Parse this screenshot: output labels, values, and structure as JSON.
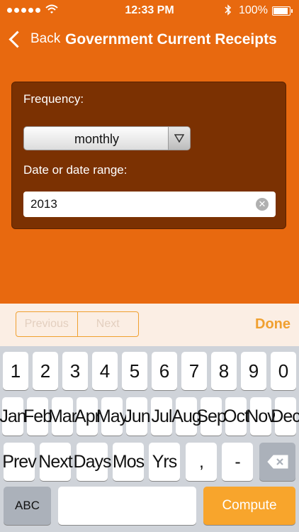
{
  "status": {
    "time": "12:33 PM",
    "battery": "100%",
    "battery_level": 1.0
  },
  "nav": {
    "back_label": "Back",
    "title": "Government Current Receipts"
  },
  "form": {
    "frequency_label": "Frequency:",
    "frequency_value": "monthly",
    "date_label": "Date or date range:",
    "date_value": "2013"
  },
  "accessory": {
    "previous": "Previous",
    "next": "Next",
    "done": "Done"
  },
  "keyboard": {
    "row1": [
      "1",
      "2",
      "3",
      "4",
      "5",
      "6",
      "7",
      "8",
      "9",
      "0"
    ],
    "row2": [
      "Jan",
      "Feb",
      "Mar",
      "Apr",
      "May",
      "Jun",
      "Jul",
      "Aug",
      "Sep",
      "Oct",
      "Nov",
      "Dec"
    ],
    "row3": [
      "Prev",
      "Next",
      "Days",
      "Mos",
      "Yrs",
      ",",
      "-"
    ],
    "abc": "ABC",
    "compute": "Compute"
  },
  "colors": {
    "background": "#e8690f",
    "panel": "#7b3102",
    "accent": "#f0a030",
    "compute": "#f8a52c"
  }
}
